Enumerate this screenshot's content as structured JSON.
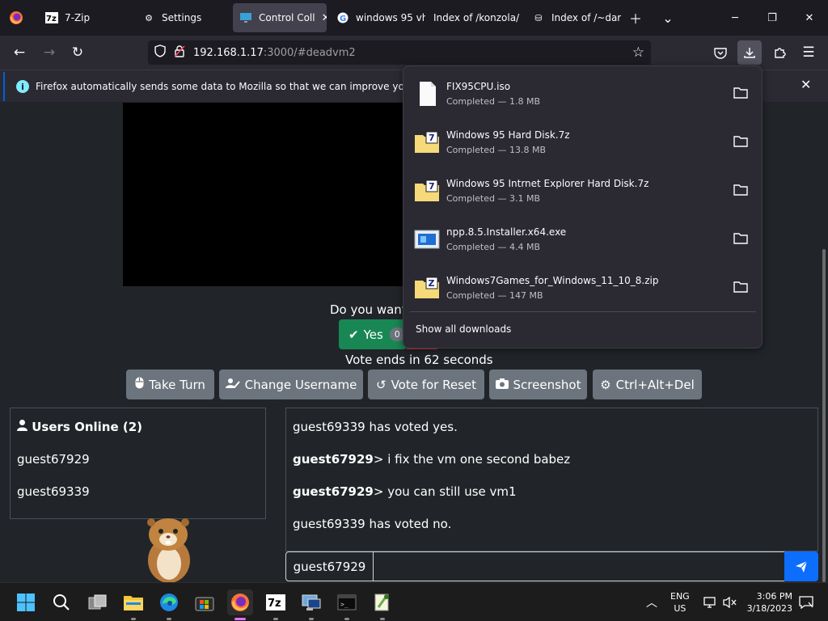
{
  "browser": {
    "tabs": [
      {
        "title": "7-Zip",
        "icon": "7zip-icon"
      },
      {
        "title": "Settings",
        "icon": "gear-icon"
      },
      {
        "title": "Control Coll",
        "icon": "monitor-icon",
        "active": true
      },
      {
        "title": "windows 95 vh",
        "icon": "google-icon"
      },
      {
        "title": "Index of /konzola/",
        "icon": "none"
      },
      {
        "title": "Index of /~dar",
        "icon": "page-icon"
      }
    ],
    "url_host": "192.168.1.17",
    "url_rest": ":3000/#deadvm2",
    "infobar_text": "Firefox automatically sends some data to Mozilla so that we can improve your experien"
  },
  "downloads": {
    "items": [
      {
        "name": "FIX95CPU.iso",
        "status": "Completed — 1.8 MB",
        "icon": "file-icon"
      },
      {
        "name": "Windows 95 Hard Disk.7z",
        "status": "Completed — 13.8 MB",
        "icon": "7z-archive-icon"
      },
      {
        "name": "Windows 95 Intrnet Explorer Hard Disk.7z",
        "status": "Completed — 3.1 MB",
        "icon": "7z-archive-icon"
      },
      {
        "name": "npp.8.5.Installer.x64.exe",
        "status": "Completed — 4.4 MB",
        "icon": "installer-icon"
      },
      {
        "name": "Windows7Games_for_Windows_11_10_8.zip",
        "status": "Completed — 147 MB",
        "icon": "zip-archive-icon"
      }
    ],
    "show_all": "Show all downloads"
  },
  "vote": {
    "question": "Do you want",
    "yes_label": "Yes",
    "yes_count": "0",
    "ends": "Vote ends in 62 seconds"
  },
  "controls": {
    "take_turn": "Take Turn",
    "change_username": "Change Username",
    "vote_reset": "Vote for Reset",
    "screenshot": "Screenshot",
    "ctrl_alt_del": "Ctrl+Alt+Del"
  },
  "users": {
    "title": "Users Online (2)",
    "list": [
      "guest67929",
      "guest69339"
    ]
  },
  "chat": {
    "messages": [
      {
        "user": "",
        "text": "guest69339 has voted yes."
      },
      {
        "user": "guest67929",
        "text": "> i fix the vm one second babez"
      },
      {
        "user": "guest67929",
        "text": "> you can still use vm1"
      },
      {
        "user": "",
        "text": "guest69339 has voted no."
      }
    ],
    "username": "guest67929",
    "input_value": ""
  },
  "taskbar": {
    "lang_top": "ENG",
    "lang_bottom": "US",
    "time": "3:06 PM",
    "date": "3/18/2023"
  },
  "colors": {
    "success": "#198754",
    "danger": "#dc3545",
    "secondary": "#6c757d",
    "primary": "#0d6efd",
    "firefox_accent": "#e56ef7"
  }
}
